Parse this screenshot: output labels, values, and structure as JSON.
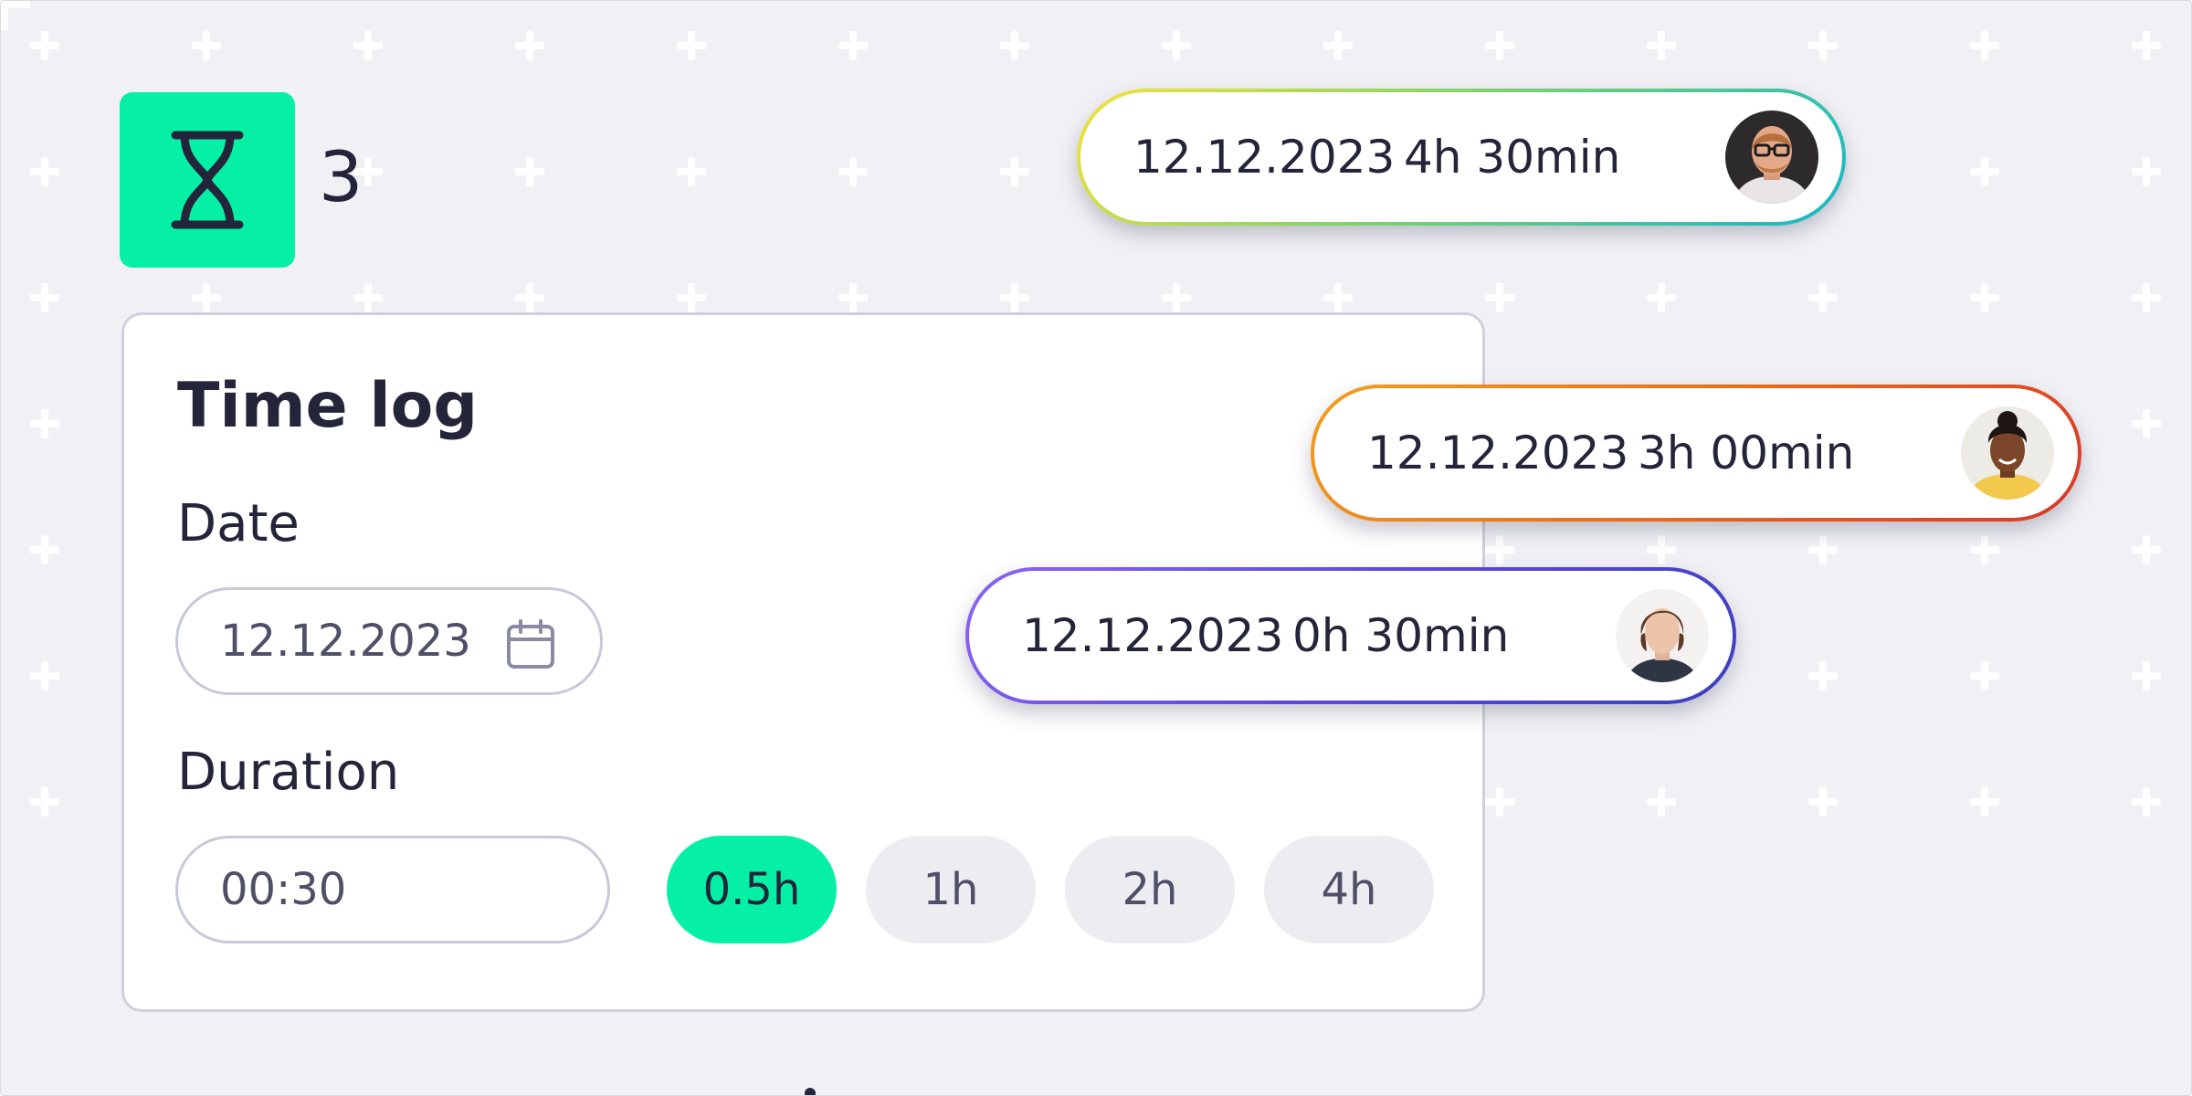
{
  "timer": {
    "count": "3",
    "icon": "hourglass-icon"
  },
  "time_log": {
    "title": "Time log",
    "date_label": "Date",
    "date_value": "12.12.2023",
    "duration_label": "Duration",
    "duration_value": "00:30",
    "presets": [
      "0.5h",
      "1h",
      "2h",
      "4h"
    ],
    "active_preset": "0.5h"
  },
  "entries": [
    {
      "date": "12.12.2023",
      "duration": "4h 30min",
      "avatar": "man-with-glasses-avatar",
      "accent": [
        "#f6e23a",
        "#15b7c8"
      ]
    },
    {
      "date": "12.12.2023",
      "duration": "3h 00min",
      "avatar": "woman-smiling-avatar",
      "accent": [
        "#f0a020",
        "#d8382a"
      ]
    },
    {
      "date": "12.12.2023",
      "duration": "0h 30min",
      "avatar": "young-man-avatar",
      "accent": [
        "#8b66f0",
        "#3b3fc0"
      ]
    }
  ],
  "colors": {
    "accent": "#05f0a5",
    "background": "#f1f1f5",
    "text": "#24253a"
  }
}
